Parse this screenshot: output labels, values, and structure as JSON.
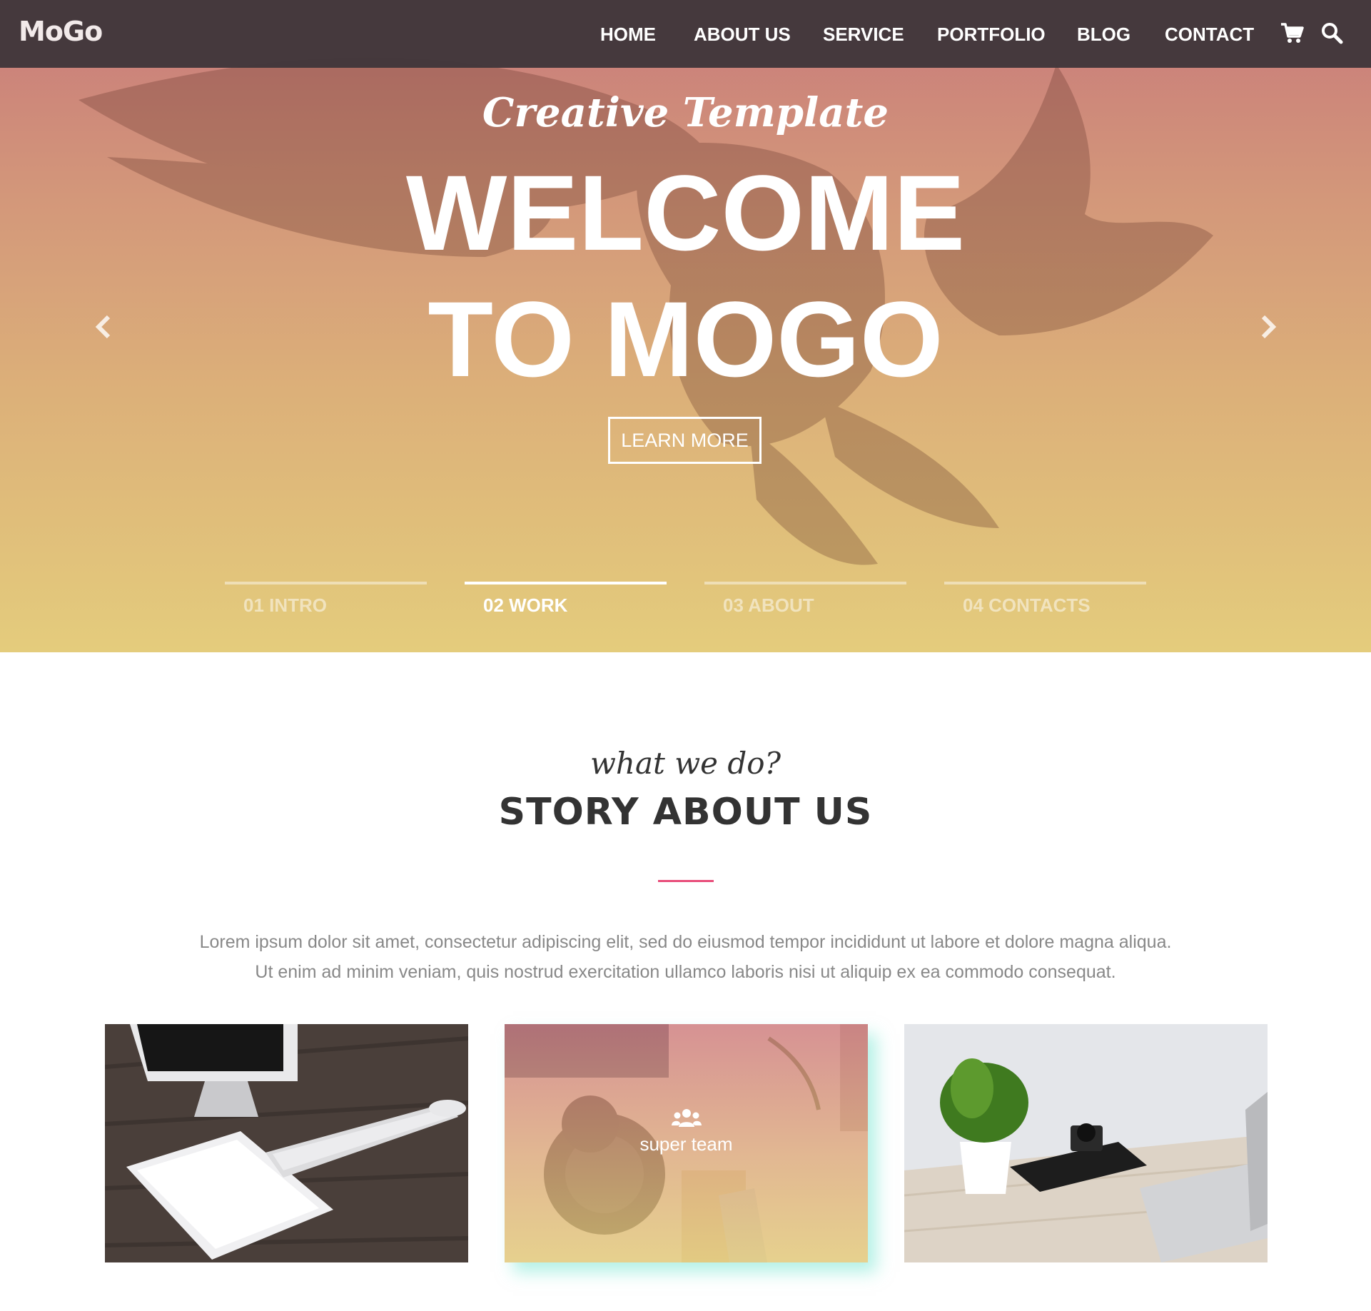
{
  "nav": {
    "logo": "MoGo",
    "items": [
      "HOME",
      "ABOUT US",
      "SERVICE",
      "PORTFOLIO",
      "BLOG",
      "CONTACT"
    ],
    "icons": [
      "cart-icon",
      "search-icon"
    ]
  },
  "hero": {
    "tagline": "Creative Template",
    "title_line1": "WELCOME",
    "title_line2": "TO MOGO",
    "button_label": "LEARN MORE",
    "arrows": [
      "chevron-left-icon",
      "chevron-right-icon"
    ],
    "slides": [
      {
        "label": "01 INTRO",
        "active": false
      },
      {
        "label": "02 WORK",
        "active": true
      },
      {
        "label": "03 ABOUT",
        "active": false
      },
      {
        "label": "04 CONTACTS",
        "active": false
      }
    ],
    "gradient_colors": [
      "#c87a7b",
      "#e4cc7c"
    ]
  },
  "about": {
    "subtitle": "what we do?",
    "title": "STORY ABOUT US",
    "accent_color": "#e84d7a",
    "text_line1": "Lorem ipsum dolor sit amet, consectetur adipiscing elit, sed do eiusmod tempor incididunt ut labore et dolore magna aliqua.",
    "text_line2": "Ut enim ad minim veniam, quis nostrud exercitation ullamco laboris nisi ut aliquip ex ea commodo consequat."
  },
  "cards": [
    {
      "caption": "",
      "image": "desk-imac-ipad-photo"
    },
    {
      "caption": "super team",
      "image": "desk-headphones-notes-photo",
      "icon": "team-icon"
    },
    {
      "caption": "",
      "image": "desk-plant-camera-photo"
    }
  ]
}
